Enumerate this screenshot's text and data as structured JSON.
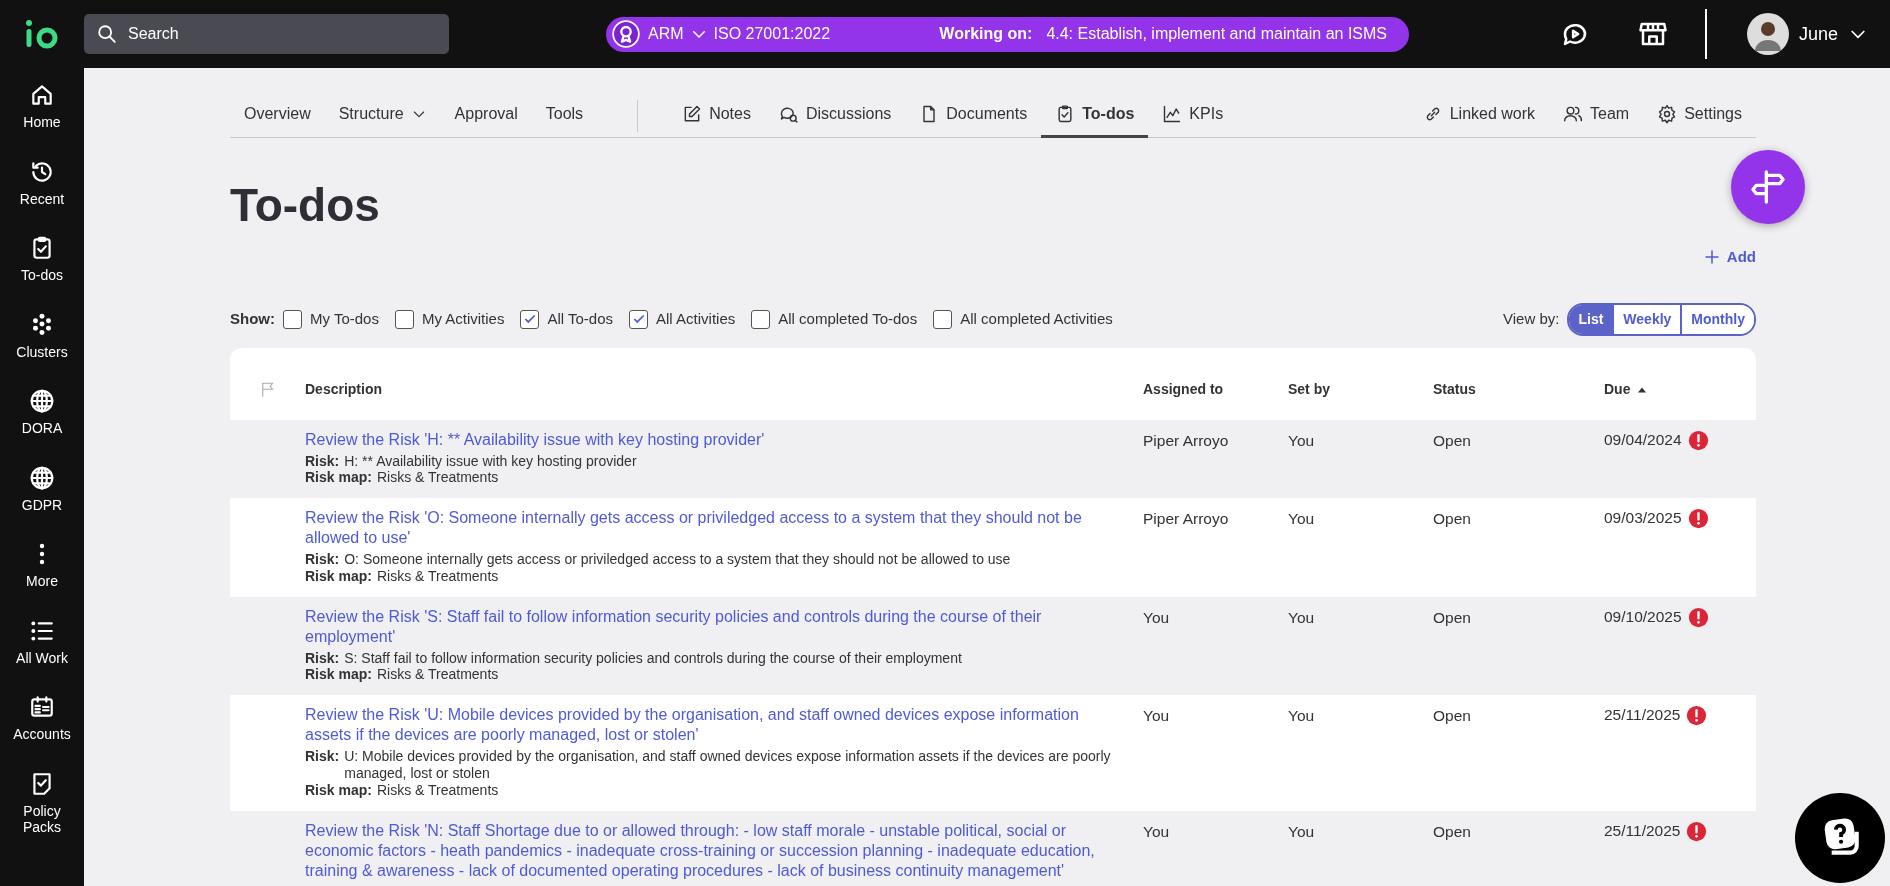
{
  "topbar": {
    "search": {
      "placeholder": "Search"
    },
    "context": {
      "org": "ARM",
      "framework": "ISO 27001:2022",
      "working_label": "Working on:",
      "working_text": "4.4: Establish, implement and maintain an ISMS"
    },
    "user": "June"
  },
  "sidebar": {
    "items": [
      {
        "label": "Home"
      },
      {
        "label": "Recent"
      },
      {
        "label": "To-dos"
      },
      {
        "label": "Clusters"
      },
      {
        "label": "DORA"
      },
      {
        "label": "GDPR"
      },
      {
        "label": "More"
      },
      {
        "label": "All Work"
      },
      {
        "label": "Accounts"
      },
      {
        "label": "Policy Packs"
      }
    ]
  },
  "tabs": [
    {
      "label": "Overview",
      "selected": false
    },
    {
      "label": "Structure",
      "selected": false,
      "dropdown": true
    },
    {
      "label": "Approval",
      "selected": false
    },
    {
      "label": "Tools",
      "selected": false
    },
    {
      "label": "Notes",
      "selected": false
    },
    {
      "label": "Discussions",
      "selected": false
    },
    {
      "label": "Documents",
      "selected": false
    },
    {
      "label": "To-dos",
      "selected": true
    },
    {
      "label": "KPIs",
      "selected": false
    },
    {
      "label": "Linked work",
      "selected": false
    },
    {
      "label": "Team",
      "selected": false
    },
    {
      "label": "Settings",
      "selected": false
    }
  ],
  "page": {
    "title": "To-dos",
    "add_label": "Add"
  },
  "filters": {
    "label": "Show:",
    "options": [
      {
        "label": "My To-dos",
        "checked": false
      },
      {
        "label": "My Activities",
        "checked": false
      },
      {
        "label": "All To-dos",
        "checked": true
      },
      {
        "label": "All Activities",
        "checked": true
      },
      {
        "label": "All completed To-dos",
        "checked": false
      },
      {
        "label": "All completed Activities",
        "checked": false
      }
    ]
  },
  "view": {
    "label": "View by:",
    "options": [
      {
        "label": "List",
        "selected": true
      },
      {
        "label": "Weekly",
        "selected": false
      },
      {
        "label": "Monthly",
        "selected": false
      }
    ]
  },
  "table": {
    "columns": [
      {
        "label": "Description",
        "sorted": false
      },
      {
        "label": "Assigned to",
        "sorted": false
      },
      {
        "label": "Set by",
        "sorted": false
      },
      {
        "label": "Status",
        "sorted": false
      },
      {
        "label": "Due",
        "sorted": true
      }
    ],
    "rows": [
      {
        "title": "Review the Risk 'H: ** Availability issue with key hosting provider'",
        "risk_label": "Risk:",
        "risk": "H: ** Availability issue with key hosting provider",
        "map_label": "Risk map:",
        "risk_map": "Risks & Treatments",
        "assigned": "Piper Arroyo",
        "set_by": "You",
        "status": "Open",
        "due": "09/04/2024",
        "overdue": true
      },
      {
        "title": "Review the Risk 'O: Someone internally gets access or priviledged access to a system that they should not be allowed to use'",
        "risk_label": "Risk:",
        "risk": "O: Someone internally gets access or priviledged access to a system that they should not be allowed to use",
        "map_label": "Risk map:",
        "risk_map": "Risks & Treatments",
        "assigned": "Piper Arroyo",
        "set_by": "You",
        "status": "Open",
        "due": "09/03/2025",
        "overdue": true
      },
      {
        "title": "Review the Risk 'S: Staff fail to follow information security policies and controls during the course of their employment'",
        "risk_label": "Risk:",
        "risk": "S: Staff fail to follow information security policies and controls during the course of their employment",
        "map_label": "Risk map:",
        "risk_map": "Risks & Treatments",
        "assigned": "You",
        "set_by": "You",
        "status": "Open",
        "due": "09/10/2025",
        "overdue": true
      },
      {
        "title": "Review the Risk 'U: Mobile devices provided by the organisation, and staff owned devices expose information assets if the devices are poorly managed, lost or stolen'",
        "risk_label": "Risk:",
        "risk": "U: Mobile devices provided by the organisation, and staff owned devices expose information assets if the devices are poorly managed, lost or stolen",
        "map_label": "Risk map:",
        "risk_map": "Risks & Treatments",
        "assigned": "You",
        "set_by": "You",
        "status": "Open",
        "due": "25/11/2025",
        "overdue": true
      },
      {
        "title": "Review the Risk 'N: Staff Shortage due to or allowed through: - low staff morale - unstable political, social or economic factors - heath pandemics - inadequate cross-training or succession planning - inadequate education, training & awareness - lack of documented operating procedures - lack of business continuity management'",
        "assigned": "You",
        "set_by": "You",
        "status": "Open",
        "due": "25/11/2025",
        "overdue": true
      }
    ]
  }
}
